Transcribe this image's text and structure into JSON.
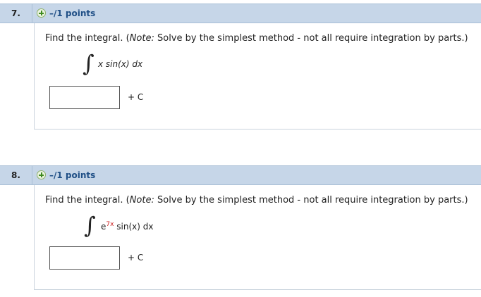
{
  "questions": [
    {
      "number": "7.",
      "points": "–/1 points",
      "prompt": {
        "before": "Find the integral. (",
        "note": "Note:",
        "after": " Solve by the simplest method - not all require integration by parts.)"
      },
      "integral_sign": "∫",
      "integrand": {
        "base": "x sin(x) dx",
        "exponent": ""
      },
      "answer": {
        "value": "",
        "placeholder": ""
      },
      "suffix": "+ C",
      "icons": [
        "plus-circle-icon"
      ]
    },
    {
      "number": "8.",
      "points": "–/1 points",
      "prompt": {
        "before": "Find the integral. (",
        "note": "Note:",
        "after": " Solve by the simplest method - not all require integration by parts.)"
      },
      "integral_sign": "∫",
      "integrand": {
        "base": "e",
        "exponent": "7x",
        "rest": " sin(x) dx"
      },
      "answer": {
        "value": "",
        "placeholder": ""
      },
      "suffix": "+ C",
      "icons": [
        "plus-circle-icon"
      ]
    }
  ],
  "colors": {
    "header_bg": "#c6d6e8",
    "points_text": "#1f4f86",
    "exponent": "#cc2222"
  }
}
